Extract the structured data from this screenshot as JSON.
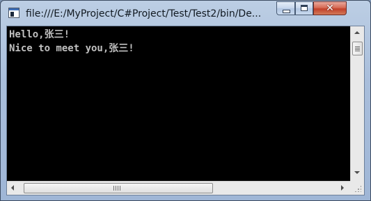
{
  "window": {
    "title": "file:///E:/MyProject/C#Project/Test/Test2/bin/De...",
    "icon": "console-app-icon",
    "buttons": {
      "minimize_icon": "minimize-icon",
      "maximize_icon": "maximize-icon",
      "close_glyph": "✕"
    }
  },
  "console": {
    "background": "#000000",
    "text_color": "#c0c0c0",
    "lines": [
      "Hello,张三!",
      "Nice to meet you,张三!"
    ]
  },
  "scrollbars": {
    "vertical": {
      "up_icon": "arrow-up-icon",
      "down_icon": "arrow-down-icon"
    },
    "horizontal": {
      "left_icon": "arrow-left-icon",
      "right_icon": "arrow-right-icon"
    }
  },
  "colors": {
    "titlebar": "#a9bedb",
    "close_button": "#c2412a",
    "scrollbar_track": "#e9e9e9"
  }
}
